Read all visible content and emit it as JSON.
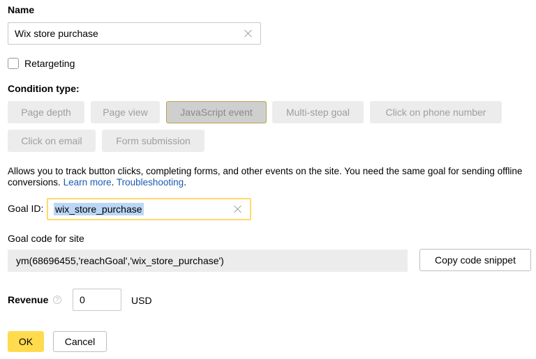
{
  "name_section": {
    "label": "Name",
    "value": "Wix store purchase"
  },
  "retargeting": {
    "label": "Retargeting",
    "checked": false
  },
  "condition_type": {
    "label": "Condition type:",
    "options": [
      {
        "label": "Page depth",
        "selected": false
      },
      {
        "label": "Page view",
        "selected": false
      },
      {
        "label": "JavaScript event",
        "selected": true
      },
      {
        "label": "Multi-step goal",
        "selected": false
      },
      {
        "label": "Click on phone number",
        "selected": false
      },
      {
        "label": "Click on email",
        "selected": false
      },
      {
        "label": "Form submission",
        "selected": false
      }
    ]
  },
  "description": {
    "text": "Allows you to track button clicks, completing forms, and other events on the site. You need the same goal for sending offline conversions.",
    "learn_more": "Learn more",
    "troubleshooting": "Troubleshooting"
  },
  "goal_id": {
    "label": "Goal ID:",
    "value": "wix_store_purchase"
  },
  "goal_code": {
    "label": "Goal code for site",
    "code": "ym(68696455,'reachGoal','wix_store_purchase')",
    "copy_label": "Copy code snippet"
  },
  "revenue": {
    "label": "Revenue",
    "help_glyph": "?",
    "value": "0",
    "currency": "USD"
  },
  "actions": {
    "ok_label": "OK",
    "cancel_label": "Cancel"
  },
  "colors": {
    "accent": "#ffdb4d",
    "link": "#1a5bb3",
    "selection": "#bcd7f5"
  }
}
